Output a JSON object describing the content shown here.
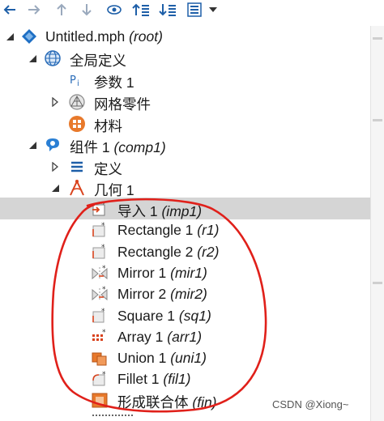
{
  "toolbar": {
    "buttons": [
      {
        "name": "back-arrow-icon"
      },
      {
        "name": "forward-arrow-icon"
      },
      {
        "name": "move-up-icon"
      },
      {
        "name": "move-down-icon"
      },
      {
        "name": "show-icon"
      },
      {
        "name": "expand-all-icon"
      },
      {
        "name": "collapse-all-icon"
      },
      {
        "name": "tree-view-icon"
      },
      {
        "name": "dropdown-chevron-icon"
      }
    ]
  },
  "tree": {
    "root": {
      "label": "Untitled.mph",
      "tag": "(root)"
    },
    "global_definitions": {
      "label": "全局定义"
    },
    "parameters": {
      "label": "参数 1"
    },
    "mesh_parts": {
      "label": "网格零件"
    },
    "materials": {
      "label": "材料"
    },
    "component": {
      "label": "组件 1",
      "tag": "(comp1)"
    },
    "definitions": {
      "label": "定义"
    },
    "geometry": {
      "label": "几何 1"
    },
    "geometry_items": [
      {
        "label": "导入 1",
        "tag": "(imp1)",
        "icon": "import-icon",
        "selected": true
      },
      {
        "label": "Rectangle 1",
        "tag": "(r1)",
        "icon": "rectangle-icon"
      },
      {
        "label": "Rectangle 2",
        "tag": "(r2)",
        "icon": "rectangle-icon"
      },
      {
        "label": "Mirror 1",
        "tag": "(mir1)",
        "icon": "mirror-icon"
      },
      {
        "label": "Mirror 2",
        "tag": "(mir2)",
        "icon": "mirror-icon"
      },
      {
        "label": "Square 1",
        "tag": "(sq1)",
        "icon": "square-icon"
      },
      {
        "label": "Array 1",
        "tag": "(arr1)",
        "icon": "array-icon"
      },
      {
        "label": "Union 1",
        "tag": "(uni1)",
        "icon": "union-icon"
      },
      {
        "label": "Fillet 1",
        "tag": "(fil1)",
        "icon": "fillet-icon"
      },
      {
        "label": "形成联合体",
        "tag": "(fin)",
        "icon": "form-union-icon"
      }
    ]
  },
  "watermark": "CSDN @Xiong~",
  "colors": {
    "selection": "#d5d5d5",
    "annotation": "#e0201a",
    "comsol_blue": "#1e6fc4",
    "orange": "#e8792b"
  }
}
